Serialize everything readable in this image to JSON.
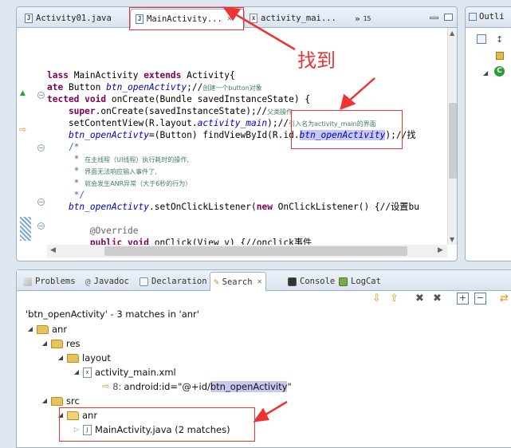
{
  "editor": {
    "tabs": [
      {
        "label": "Activity01.java"
      },
      {
        "label": "MainActivity..."
      },
      {
        "label": "activity_mai..."
      }
    ],
    "overflow_count": "15",
    "code_lines": [
      {
        "segments": [
          {
            "t": "lass ",
            "c": "kw"
          },
          {
            "t": "MainActivity ",
            "c": ""
          },
          {
            "t": "extends ",
            "c": "kw"
          },
          {
            "t": "Activity{",
            "c": ""
          }
        ]
      },
      {
        "segments": [
          {
            "t": "ate ",
            "c": "kw"
          },
          {
            "t": "Button ",
            "c": ""
          },
          {
            "t": "btn_openActivty",
            "c": "fld"
          },
          {
            "t": ";//",
            "c": ""
          },
          {
            "t": "创建一个button对象",
            "c": "cmt"
          }
        ]
      },
      {
        "segments": [
          {
            "t": "tected ",
            "c": "kw"
          },
          {
            "t": "void ",
            "c": "kw"
          },
          {
            "t": "onCreate(Bundle savedInstanceState) {",
            "c": ""
          }
        ]
      },
      {
        "segments": [
          {
            "t": "    super",
            "c": "kw"
          },
          {
            "t": ".onCreate(savedInstanceState);//",
            "c": ""
          },
          {
            "t": "父类操作",
            "c": "cmt"
          }
        ]
      },
      {
        "segments": [
          {
            "t": "    setContentView(R.layout.",
            "c": ""
          },
          {
            "t": "activity_main",
            "c": "fld"
          },
          {
            "t": ");//",
            "c": ""
          },
          {
            "t": "引入名为activity_main的界面",
            "c": "cmt"
          }
        ]
      },
      {
        "segments": [
          {
            "t": "    ",
            "c": ""
          },
          {
            "t": "btn_openActivty",
            "c": "fld"
          },
          {
            "t": "=(Button) findViewById(R.id.",
            "c": ""
          },
          {
            "t": "btn_openActivity",
            "c": "fld hl"
          },
          {
            "t": ");//找",
            "c": ""
          }
        ]
      },
      {
        "segments": [
          {
            "t": "    /*",
            "c": "jd"
          }
        ]
      },
      {
        "segments": [
          {
            "t": "     * ",
            "c": "jd"
          },
          {
            "t": "在主线程（UI线程）执行耗时的操作,",
            "c": "cmt"
          }
        ]
      },
      {
        "segments": [
          {
            "t": "     * ",
            "c": "jd"
          },
          {
            "t": "界面无法响应输入事件了,",
            "c": "cmt"
          }
        ]
      },
      {
        "segments": [
          {
            "t": "     * ",
            "c": "jd"
          },
          {
            "t": "就会发生ANR异常（大于6秒的行为）",
            "c": "cmt"
          }
        ]
      },
      {
        "segments": [
          {
            "t": "     */",
            "c": "jd"
          }
        ]
      },
      {
        "segments": [
          {
            "t": "    ",
            "c": ""
          },
          {
            "t": "btn_openActivty",
            "c": "fld"
          },
          {
            "t": ".setOnClickListener(",
            "c": ""
          },
          {
            "t": "new ",
            "c": "kw"
          },
          {
            "t": "OnClickListener() {//设置bu",
            "c": ""
          }
        ]
      },
      {
        "segments": [
          {
            "t": "",
            "c": ""
          }
        ]
      },
      {
        "segments": [
          {
            "t": "        @Override",
            "c": "ann"
          }
        ]
      },
      {
        "segments": [
          {
            "t": "        public ",
            "c": "kw"
          },
          {
            "t": "void ",
            "c": "kw"
          },
          {
            "t": "onClick(View v) {//onclick事件",
            "c": ""
          }
        ]
      }
    ]
  },
  "outline": {
    "label": "Outli"
  },
  "annotation": {
    "label": "找到"
  },
  "bottom": {
    "tabs": [
      {
        "label": "Problems"
      },
      {
        "label": "Javadoc"
      },
      {
        "label": "Declaration"
      },
      {
        "label": "Search"
      },
      {
        "label": "Console"
      },
      {
        "label": "LogCat"
      }
    ],
    "status": "'btn_openActivity' - 3 matches in 'anr'",
    "tree": {
      "project": "anr",
      "res": "res",
      "layout": "layout",
      "layout_file": "activity_main.xml",
      "match_line": "8:",
      "match_prefix": "android:id=\"@+id/",
      "match_hit": "btn_openActivity",
      "match_suffix": "\"",
      "src": "src",
      "package": "anr",
      "java_file": "MainActivity.java (2 matches)"
    }
  },
  "colors": {
    "annotation_red": "#e33333",
    "highlight": "#c7c7ef"
  }
}
